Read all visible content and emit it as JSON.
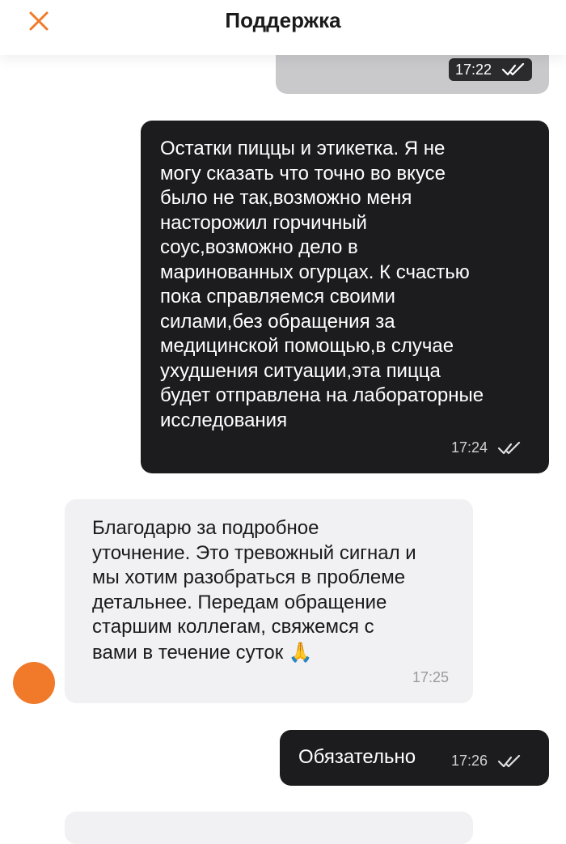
{
  "header": {
    "title": "Поддержка",
    "close_icon": "close-icon",
    "accent_color": "#f07a2a"
  },
  "messages": [
    {
      "id": "m0",
      "sender": "user",
      "time": "17:22",
      "status": "read"
    },
    {
      "id": "m1",
      "sender": "user",
      "text": "Остатки пиццы и этикетка. Я не\nмогу сказать что точно во вкусе\nбыло не так,возможно меня\nнасторожил горчичный\nсоус,возможно дело в\nмаринованных огурцах. К счастью\nпока справляемся своими\nсилами,без обращения за\nмедицинской помощью,в  случае\nухудшения ситуации,эта пицца\nбудет отправлена на лабораторные\nисследования",
      "time": "17:24",
      "status": "read"
    },
    {
      "id": "m2",
      "sender": "support",
      "text": "Благодарю за подробное\nуточнение. Это тревожный сигнал и\nмы хотим разобраться в проблеме\nдетальнее. Передам обращение\nстаршим коллегам, свяжемся с\nвами в течение суток",
      "emoji": "🙏",
      "time": "17:25"
    },
    {
      "id": "m3",
      "sender": "user",
      "text": "Обязательно",
      "time": "17:26",
      "status": "read"
    }
  ]
}
